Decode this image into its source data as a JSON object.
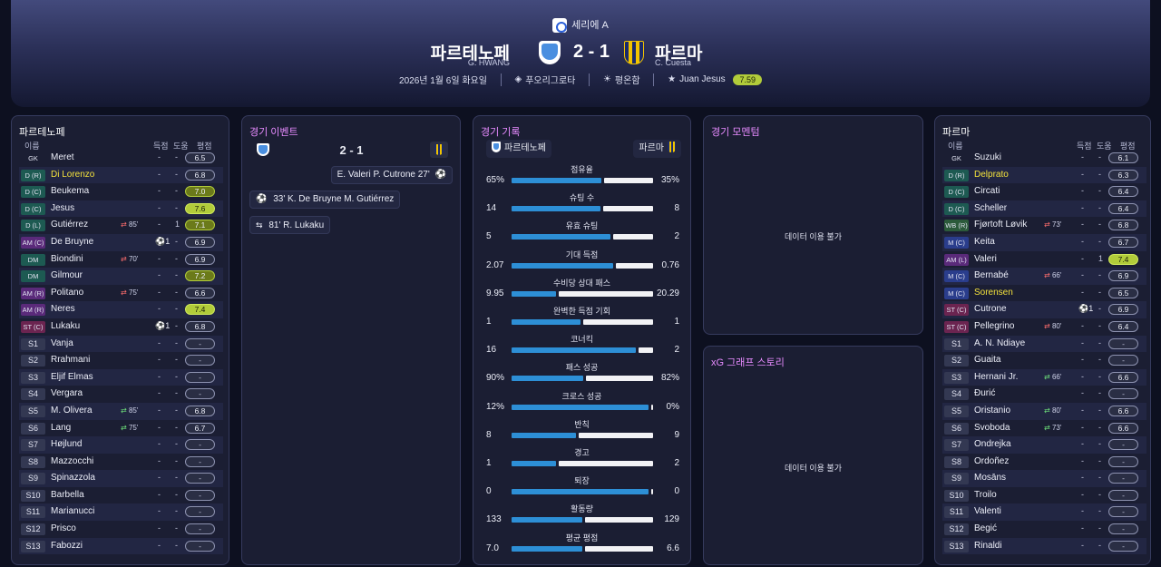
{
  "header": {
    "competition": "세리에 A",
    "home_team": "파르테노페",
    "home_manager": "G. HWANG",
    "away_team": "파르마",
    "away_manager": "C. Cuesta",
    "score": "2 - 1",
    "date": "2026년 1월 6일 화요일",
    "stadium": "푸오리그로타",
    "weather": "평온함",
    "pom_name": "Juan Jesus",
    "pom_rating": "7.59"
  },
  "home_panel": {
    "title": "파르테노페",
    "col_name": "이름",
    "col_goals": "득점",
    "col_assists": "도움",
    "col_rating": "평점",
    "players": [
      {
        "pos": "GK",
        "cls": "gk",
        "name": "Meret",
        "g": "-",
        "a": "-",
        "r": "6.5",
        "rc": ""
      },
      {
        "pos": "D (R)",
        "cls": "d",
        "name": "Di Lorenzo",
        "hl": true,
        "g": "-",
        "a": "-",
        "r": "6.8",
        "rc": ""
      },
      {
        "pos": "D (C)",
        "cls": "d",
        "name": "Beukema",
        "g": "-",
        "a": "-",
        "r": "7.0",
        "rc": "good"
      },
      {
        "pos": "D (C)",
        "cls": "d",
        "name": "Jesus",
        "g": "-",
        "a": "-",
        "r": "7.6",
        "rc": "great"
      },
      {
        "pos": "D (L)",
        "cls": "d",
        "name": "Gutiérrez",
        "sub": "85'",
        "sub_dir": "out",
        "g": "-",
        "a": "1",
        "r": "7.1",
        "rc": "good"
      },
      {
        "pos": "AM (C)",
        "cls": "am",
        "name": "De Bruyne",
        "ball": "⚽1",
        "g": "",
        "a": "-",
        "r": "6.9",
        "rc": ""
      },
      {
        "pos": "DM",
        "cls": "d",
        "name": "Biondini",
        "sub": "70'",
        "sub_dir": "out",
        "g": "-",
        "a": "-",
        "r": "6.9",
        "rc": ""
      },
      {
        "pos": "DM",
        "cls": "d",
        "name": "Gilmour",
        "g": "-",
        "a": "-",
        "r": "7.2",
        "rc": "good"
      },
      {
        "pos": "AM (R)",
        "cls": "am",
        "name": "Politano",
        "sub": "75'",
        "sub_dir": "out",
        "g": "-",
        "a": "-",
        "r": "6.6",
        "rc": ""
      },
      {
        "pos": "AM (R)",
        "cls": "am",
        "name": "Neres",
        "g": "-",
        "a": "-",
        "r": "7.4",
        "rc": "great"
      },
      {
        "pos": "ST (C)",
        "cls": "st",
        "name": "Lukaku",
        "ball": "⚽1",
        "g": "",
        "a": "-",
        "r": "6.8",
        "rc": ""
      },
      {
        "pos": "S1",
        "cls": "s",
        "name": "Vanja",
        "g": "-",
        "a": "-",
        "r": "-",
        "rc": "none"
      },
      {
        "pos": "S2",
        "cls": "s",
        "name": "Rrahmani",
        "g": "-",
        "a": "-",
        "r": "-",
        "rc": "none"
      },
      {
        "pos": "S3",
        "cls": "s",
        "name": "Eljif Elmas",
        "g": "-",
        "a": "-",
        "r": "-",
        "rc": "none"
      },
      {
        "pos": "S4",
        "cls": "s",
        "name": "Vergara",
        "g": "-",
        "a": "-",
        "r": "-",
        "rc": "none"
      },
      {
        "pos": "S5",
        "cls": "s",
        "name": "M. Olivera",
        "sub": "85'",
        "sub_dir": "in",
        "g": "-",
        "a": "-",
        "r": "6.8",
        "rc": ""
      },
      {
        "pos": "S6",
        "cls": "s",
        "name": "Lang",
        "sub": "75'",
        "sub_dir": "in",
        "g": "-",
        "a": "-",
        "r": "6.7",
        "rc": ""
      },
      {
        "pos": "S7",
        "cls": "s",
        "name": "Højlund",
        "g": "-",
        "a": "-",
        "r": "-",
        "rc": "none"
      },
      {
        "pos": "S8",
        "cls": "s",
        "name": "Mazzocchi",
        "g": "-",
        "a": "-",
        "r": "-",
        "rc": "none"
      },
      {
        "pos": "S9",
        "cls": "s",
        "name": "Spinazzola",
        "g": "-",
        "a": "-",
        "r": "-",
        "rc": "none"
      },
      {
        "pos": "S10",
        "cls": "s",
        "name": "Barbella",
        "g": "-",
        "a": "-",
        "r": "-",
        "rc": "none"
      },
      {
        "pos": "S11",
        "cls": "s",
        "name": "Marianucci",
        "g": "-",
        "a": "-",
        "r": "-",
        "rc": "none"
      },
      {
        "pos": "S12",
        "cls": "s",
        "name": "Prisco",
        "g": "-",
        "a": "-",
        "r": "-",
        "rc": "none"
      },
      {
        "pos": "S13",
        "cls": "s",
        "name": "Fabozzi",
        "g": "-",
        "a": "-",
        "r": "-",
        "rc": "none"
      }
    ]
  },
  "events_panel": {
    "title": "경기 이벤트",
    "score": "2 - 1",
    "events": [
      {
        "text": "E. Valeri  P. Cutrone  27'",
        "icon": "⚽",
        "side": "away"
      },
      {
        "text": "33'  K. De Bruyne  M. Gutiérrez",
        "icon": "⚽",
        "side": "home"
      },
      {
        "text": "81'  R. Lukaku",
        "icon": "🟥",
        "side": "home"
      }
    ]
  },
  "stats_panel": {
    "title": "경기 기록",
    "home": "파르테노페",
    "away": "파르마",
    "stats": [
      {
        "label": "점유율",
        "home": "65%",
        "away": "35%",
        "hf": 0.65
      },
      {
        "label": "슈팅 수",
        "home": "14",
        "away": "8",
        "hf": 0.64
      },
      {
        "label": "유효 슈팅",
        "home": "5",
        "away": "2",
        "hf": 0.71
      },
      {
        "label": "기대 득점",
        "home": "2.07",
        "away": "0.76",
        "hf": 0.73
      },
      {
        "label": "수비당 상대 패스",
        "home": "9.95",
        "away": "20.29",
        "hf": 0.33
      },
      {
        "label": "완벽한 득점 기회",
        "home": "1",
        "away": "1",
        "hf": 0.5
      },
      {
        "label": "코너킥",
        "home": "16",
        "away": "2",
        "hf": 0.89
      },
      {
        "label": "패스 성공",
        "home": "90%",
        "away": "82%",
        "hf": 0.52
      },
      {
        "label": "크로스 성공",
        "home": "12%",
        "away": "0%",
        "hf": 0.98
      },
      {
        "label": "반칙",
        "home": "8",
        "away": "9",
        "hf": 0.47
      },
      {
        "label": "경고",
        "home": "1",
        "away": "2",
        "hf": 0.33
      },
      {
        "label": "퇴장",
        "home": "0",
        "away": "0",
        "hf": 0.98
      },
      {
        "label": "활동량",
        "home": "133",
        "away": "129",
        "hf": 0.51
      },
      {
        "label": "평균 평점",
        "home": "7.0",
        "away": "6.6",
        "hf": 0.51
      }
    ]
  },
  "momentum_panel": {
    "title": "경기 모멘텀",
    "empty": "데이터 이용 불가"
  },
  "xg_panel": {
    "title": "xG 그래프 스토리",
    "empty": "데이터 이용 불가"
  },
  "away_panel": {
    "title": "파르마",
    "col_name": "이름",
    "col_goals": "득점",
    "col_assists": "도움",
    "col_rating": "평점",
    "players": [
      {
        "pos": "GK",
        "cls": "gk",
        "name": "Suzuki",
        "g": "-",
        "a": "-",
        "r": "6.1",
        "rc": ""
      },
      {
        "pos": "D (R)",
        "cls": "d",
        "name": "Delprato",
        "hl": true,
        "g": "-",
        "a": "-",
        "r": "6.3",
        "rc": ""
      },
      {
        "pos": "D (C)",
        "cls": "d",
        "name": "Circati",
        "g": "-",
        "a": "-",
        "r": "6.4",
        "rc": ""
      },
      {
        "pos": "D (C)",
        "cls": "d",
        "name": "Scheller",
        "g": "-",
        "a": "-",
        "r": "6.4",
        "rc": ""
      },
      {
        "pos": "WB (R)",
        "cls": "wb",
        "name": "Fjørtoft Løvik",
        "sub": "73'",
        "sub_dir": "out",
        "g": "-",
        "a": "-",
        "r": "6.8",
        "rc": ""
      },
      {
        "pos": "M (C)",
        "cls": "m",
        "name": "Keita",
        "g": "-",
        "a": "-",
        "r": "6.7",
        "rc": ""
      },
      {
        "pos": "AM (L)",
        "cls": "am",
        "name": "Valeri",
        "g": "-",
        "a": "1",
        "r": "7.4",
        "rc": "great"
      },
      {
        "pos": "M (C)",
        "cls": "m",
        "name": "Bernabé",
        "sub": "66'",
        "sub_dir": "out",
        "g": "-",
        "a": "-",
        "r": "6.9",
        "rc": ""
      },
      {
        "pos": "M (C)",
        "cls": "m",
        "name": "Sorensen",
        "hl": true,
        "g": "-",
        "a": "-",
        "r": "6.5",
        "rc": ""
      },
      {
        "pos": "ST (C)",
        "cls": "st",
        "name": "Cutrone",
        "ball": "⚽1",
        "g": "",
        "a": "-",
        "r": "6.9",
        "rc": ""
      },
      {
        "pos": "ST (C)",
        "cls": "st",
        "name": "Pellegrino",
        "sub": "80'",
        "sub_dir": "out",
        "g": "-",
        "a": "-",
        "r": "6.4",
        "rc": ""
      },
      {
        "pos": "S1",
        "cls": "s",
        "name": "A. N. Ndiaye",
        "g": "-",
        "a": "-",
        "r": "-",
        "rc": "none"
      },
      {
        "pos": "S2",
        "cls": "s",
        "name": "Guaita",
        "g": "-",
        "a": "-",
        "r": "-",
        "rc": "none"
      },
      {
        "pos": "S3",
        "cls": "s",
        "name": "Hernani Jr.",
        "sub": "66'",
        "sub_dir": "in",
        "g": "-",
        "a": "-",
        "r": "6.6",
        "rc": ""
      },
      {
        "pos": "S4",
        "cls": "s",
        "name": "Đurić",
        "g": "-",
        "a": "-",
        "r": "-",
        "rc": "none"
      },
      {
        "pos": "S5",
        "cls": "s",
        "name": "Oristanio",
        "sub": "80'",
        "sub_dir": "in",
        "g": "-",
        "a": "-",
        "r": "6.6",
        "rc": ""
      },
      {
        "pos": "S6",
        "cls": "s",
        "name": "Svoboda",
        "sub": "73'",
        "sub_dir": "in",
        "g": "-",
        "a": "-",
        "r": "6.6",
        "rc": ""
      },
      {
        "pos": "S7",
        "cls": "s",
        "name": "Ondrejka",
        "g": "-",
        "a": "-",
        "r": "-",
        "rc": "none"
      },
      {
        "pos": "S8",
        "cls": "s",
        "name": "Ordoñez",
        "g": "-",
        "a": "-",
        "r": "-",
        "rc": "none"
      },
      {
        "pos": "S9",
        "cls": "s",
        "name": "Mosāns",
        "g": "-",
        "a": "-",
        "r": "-",
        "rc": "none"
      },
      {
        "pos": "S10",
        "cls": "s",
        "name": "Troilo",
        "g": "-",
        "a": "-",
        "r": "-",
        "rc": "none"
      },
      {
        "pos": "S11",
        "cls": "s",
        "name": "Valenti",
        "g": "-",
        "a": "-",
        "r": "-",
        "rc": "none"
      },
      {
        "pos": "S12",
        "cls": "s",
        "name": "Begić",
        "g": "-",
        "a": "-",
        "r": "-",
        "rc": "none"
      },
      {
        "pos": "S13",
        "cls": "s",
        "name": "Rinaldi",
        "g": "-",
        "a": "-",
        "r": "-",
        "rc": "none"
      }
    ]
  }
}
